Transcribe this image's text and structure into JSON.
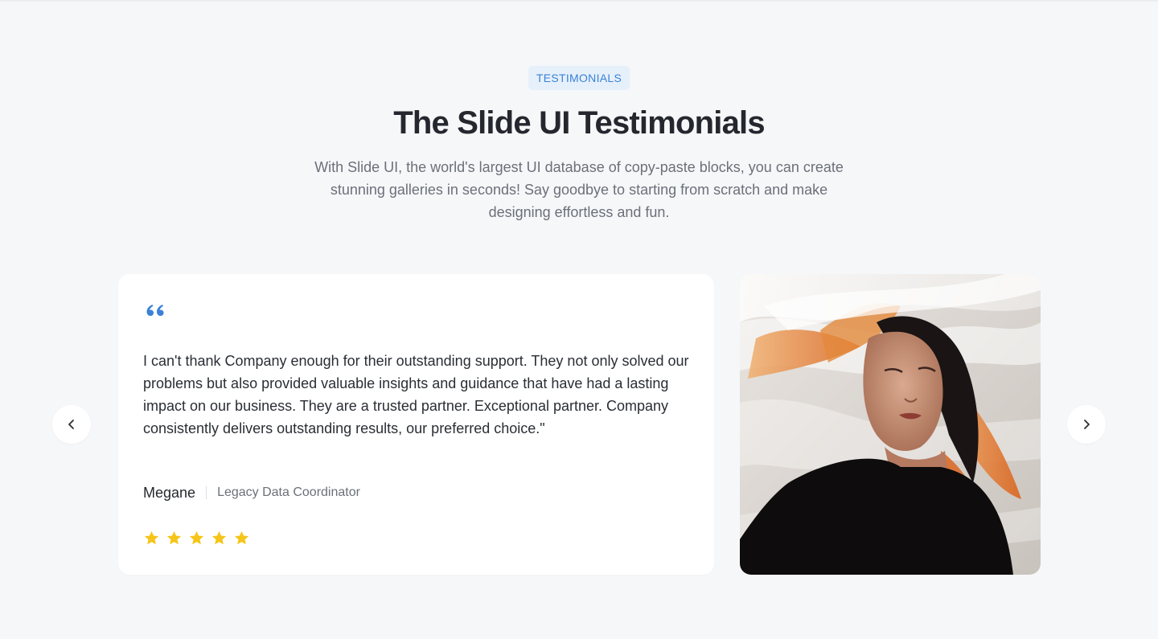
{
  "section": {
    "badge": "TESTIMONIALS",
    "title": "The Slide UI Testimonials",
    "subtitle": "With Slide UI, the world's largest UI database of copy-paste blocks, you can create stunning galleries in seconds! Say goodbye to starting from scratch and make designing effortless and fun."
  },
  "testimonial": {
    "quote": "I can't thank Company enough for their outstanding support. They not only solved our problems but also provided valuable insights and guidance that have had a lasting impact on our business. They are a trusted partner. Exceptional partner. Company consistently delivers outstanding results, our preferred choice.\"",
    "author_name": "Megane",
    "author_role": "Legacy Data Coordinator",
    "rating": 5,
    "rating_max": 5,
    "photo_icon": "portrait-photo"
  },
  "navigation": {
    "prev_icon": "chevron-left-icon",
    "next_icon": "chevron-right-icon"
  },
  "colors": {
    "background": "#f6f7f9",
    "accent": "#3b82d6",
    "badge_bg": "#e6f0fb",
    "star": "#f5c518",
    "card": "#ffffff"
  }
}
